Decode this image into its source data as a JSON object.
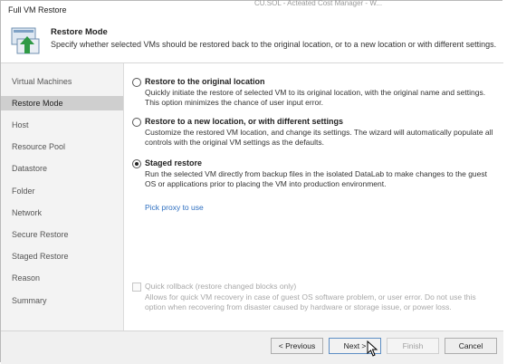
{
  "window": {
    "title": "Full VM Restore"
  },
  "background_text": "CU.SOL - Acteated Cost Manager - W...",
  "header": {
    "title": "Restore Mode",
    "description": "Specify whether selected VMs should be restored back to the original location, or to a new location or with different settings.",
    "icon": "restore-arrow-icon"
  },
  "sidebar": {
    "items": [
      {
        "label": "Virtual Machines",
        "active": false
      },
      {
        "label": "Restore Mode",
        "active": true
      },
      {
        "label": "Host",
        "active": false
      },
      {
        "label": "Resource Pool",
        "active": false
      },
      {
        "label": "Datastore",
        "active": false
      },
      {
        "label": "Folder",
        "active": false
      },
      {
        "label": "Network",
        "active": false
      },
      {
        "label": "Secure Restore",
        "active": false
      },
      {
        "label": "Staged Restore",
        "active": false
      },
      {
        "label": "Reason",
        "active": false
      },
      {
        "label": "Summary",
        "active": false
      }
    ]
  },
  "options": [
    {
      "label": "Restore to the original location",
      "description": "Quickly initiate the restore of selected VM to its original location, with the original name and settings. This option minimizes the chance of user input error.",
      "checked": false
    },
    {
      "label": "Restore to a new location, or with different settings",
      "description": "Customize the restored VM location, and change its settings. The wizard will automatically populate all controls with the original VM settings as the defaults.",
      "checked": false
    },
    {
      "label": "Staged restore",
      "description": "Run the selected VM directly from backup files in the isolated DataLab to make changes to the guest OS or applications prior to placing the VM into production environment.",
      "checked": true
    }
  ],
  "proxy_link": "Pick proxy to use",
  "quick_rollback": {
    "label": "Quick rollback (restore changed blocks only)",
    "description": "Allows for quick VM recovery in case of guest OS software problem, or user error. Do not use this option when recovering from disaster caused by hardware or storage issue, or power loss.",
    "checked": false,
    "enabled": false
  },
  "buttons": {
    "previous": "< Previous",
    "next": "Next >",
    "finish": "Finish",
    "cancel": "Cancel"
  },
  "colors": {
    "link": "#2e6fc0",
    "sidebar_bg": "#f3f3f3",
    "sidebar_active": "#cfcfcf",
    "disabled_text": "#a8a8a8",
    "icon_green": "#2f9a45"
  }
}
